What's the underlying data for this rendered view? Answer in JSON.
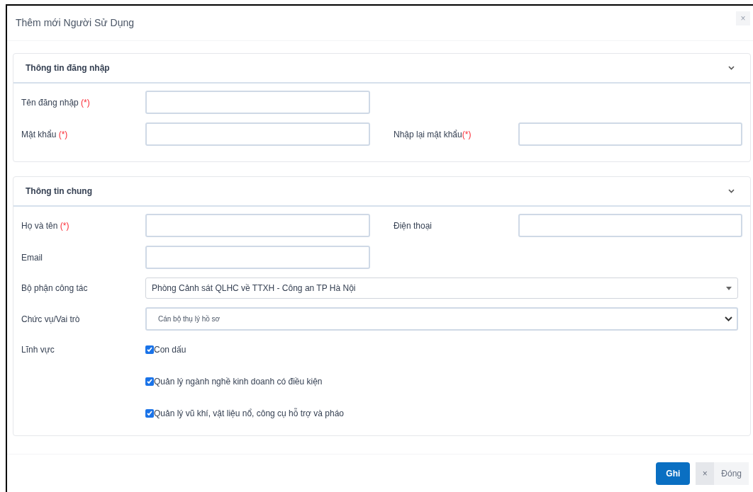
{
  "dialog": {
    "title": "Thêm mới Người Sử Dụng",
    "close": "×"
  },
  "sections": [
    {
      "title": "Thông tin đăng nhập",
      "expanded": true,
      "rows": [
        [
          {
            "label": "Tên đăng nhập",
            "required_mark": "(*)",
            "kind": "text"
          }
        ],
        [
          {
            "label": "Mật khẩu",
            "required_mark": "(*)",
            "kind": "text"
          },
          {
            "label": "Nhập lại mật khẩu",
            "required_mark": "(*)",
            "kind": "text"
          }
        ]
      ]
    },
    {
      "title": "Thông tin chung",
      "expanded": true,
      "rows": [
        [
          {
            "label": "Họ và tên",
            "required_mark": "(*)",
            "kind": "text"
          },
          {
            "label": "Điện thoại",
            "kind": "text"
          }
        ],
        [
          {
            "label": "Email",
            "kind": "text"
          }
        ],
        [
          {
            "label": "Bộ phận công tác",
            "kind": "combo",
            "value": "Phòng Cảnh sát QLHC về TTXH - Công an TP Hà Nội"
          }
        ],
        [
          {
            "label": "Chức vụ/Vai trò",
            "kind": "select",
            "value": "Cán bộ thụ lý hồ sơ"
          }
        ],
        [
          {
            "label": "Lĩnh vực",
            "kind": "checkboxes",
            "options": [
              {
                "label": "Con dấu",
                "checked": true
              },
              {
                "label": "Quản lý ngành nghề kinh doanh có điều kiện",
                "checked": true
              },
              {
                "label": "Quản lý vũ khí, vật liệu nổ, công cụ hỗ trợ và pháo",
                "checked": true
              }
            ]
          }
        ]
      ]
    }
  ],
  "footer": {
    "save": "Ghi",
    "close_icon": "×",
    "close": "Đóng"
  }
}
